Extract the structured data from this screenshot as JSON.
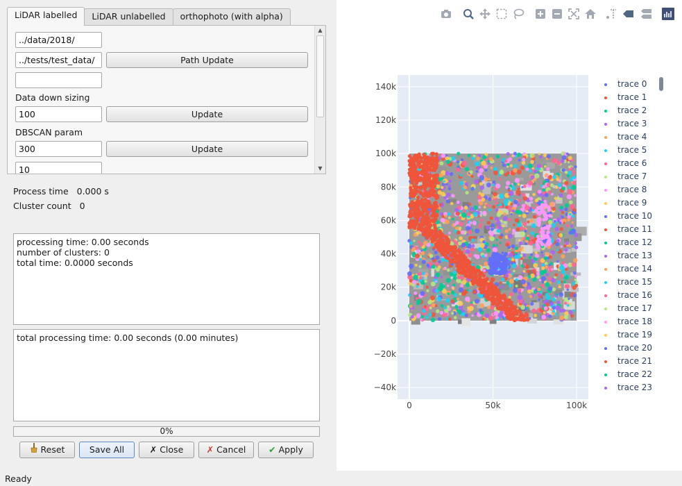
{
  "tabs": [
    "LiDAR labelled",
    "LiDAR unlabelled",
    "orthophoto (with alpha)"
  ],
  "form": {
    "data_path": "../data/2018/",
    "test_path": "../tests/test_data/",
    "path_update_label": "Path Update",
    "empty_field": "",
    "downsize_label": "Data down sizing",
    "downsize_value": "100",
    "update_label": "Update",
    "dbscan_label": "DBSCAN param",
    "dbscan_eps": "300",
    "dbscan_update_label": "Update",
    "dbscan_min": "10"
  },
  "stats": {
    "process_time_label": "Process time",
    "process_time_value": "0.000 s",
    "cluster_count_label": "Cluster count",
    "cluster_count_value": "0"
  },
  "log1": "processing time: 0.00 seconds\nnumber of clusters: 0\ntotal time: 0.0000 seconds",
  "log2": "total processing time: 0.00 seconds (0.00 minutes)",
  "progress": {
    "text": "0%",
    "value": 0
  },
  "buttons": {
    "reset": "Reset",
    "save_all": "Save All",
    "close": "Close",
    "cancel": "Cancel",
    "apply": "Apply"
  },
  "status": "Ready",
  "plot": {
    "modebar_icons": [
      "camera-icon",
      "zoom-icon",
      "pan-icon",
      "box-select-icon",
      "lasso-icon",
      "zoom-in-icon",
      "zoom-out-icon",
      "autoscale-icon",
      "home-icon",
      "spike-lines-icon",
      "hover-closest-icon",
      "hover-compare-icon",
      "plotly-logo-icon"
    ],
    "y_ticks": [
      "140k",
      "120k",
      "100k",
      "80k",
      "60k",
      "40k",
      "20k",
      "0",
      "−20k",
      "−40k"
    ],
    "x_ticks": [
      "0",
      "50k",
      "100k"
    ],
    "legend": [
      "trace 0",
      "trace 1",
      "trace 2",
      "trace 3",
      "trace 4",
      "trace 5",
      "trace 6",
      "trace 7",
      "trace 8",
      "trace 9",
      "trace 10",
      "trace 11",
      "trace 12",
      "trace 13",
      "trace 14",
      "trace 15",
      "trace 16",
      "trace 17",
      "trace 18",
      "trace 19",
      "trace 20",
      "trace 21",
      "trace 22",
      "trace 23"
    ],
    "colors": [
      "#636efa",
      "#ef553b",
      "#00cc96",
      "#ab63fa",
      "#ffa15a",
      "#19d3f3",
      "#ff6692",
      "#b6e880",
      "#ff97ff",
      "#fecb52"
    ],
    "plot_bg": "#e5ecf6"
  },
  "chart_data": {
    "type": "scatter",
    "x_range": [
      -7000,
      107000
    ],
    "y_range": [
      -47000,
      147000
    ],
    "x_ticks": [
      0,
      50000,
      100000
    ],
    "y_ticks": [
      -40000,
      -20000,
      0,
      20000,
      40000,
      60000,
      80000,
      100000,
      120000,
      140000
    ],
    "data_extent": {
      "x": [
        0,
        100000
      ],
      "y": [
        0,
        100000
      ]
    },
    "series": [
      {
        "name": "trace 0"
      },
      {
        "name": "trace 1"
      },
      {
        "name": "trace 2"
      },
      {
        "name": "trace 3"
      },
      {
        "name": "trace 4"
      },
      {
        "name": "trace 5"
      },
      {
        "name": "trace 6"
      },
      {
        "name": "trace 7"
      },
      {
        "name": "trace 8"
      },
      {
        "name": "trace 9"
      },
      {
        "name": "trace 10"
      },
      {
        "name": "trace 11"
      },
      {
        "name": "trace 12"
      },
      {
        "name": "trace 13"
      },
      {
        "name": "trace 14"
      },
      {
        "name": "trace 15"
      },
      {
        "name": "trace 16"
      },
      {
        "name": "trace 17"
      },
      {
        "name": "trace 18"
      },
      {
        "name": "trace 19"
      },
      {
        "name": "trace 20"
      },
      {
        "name": "trace 21"
      },
      {
        "name": "trace 22"
      },
      {
        "name": "trace 23"
      }
    ],
    "grid": true,
    "legend_position": "right"
  }
}
